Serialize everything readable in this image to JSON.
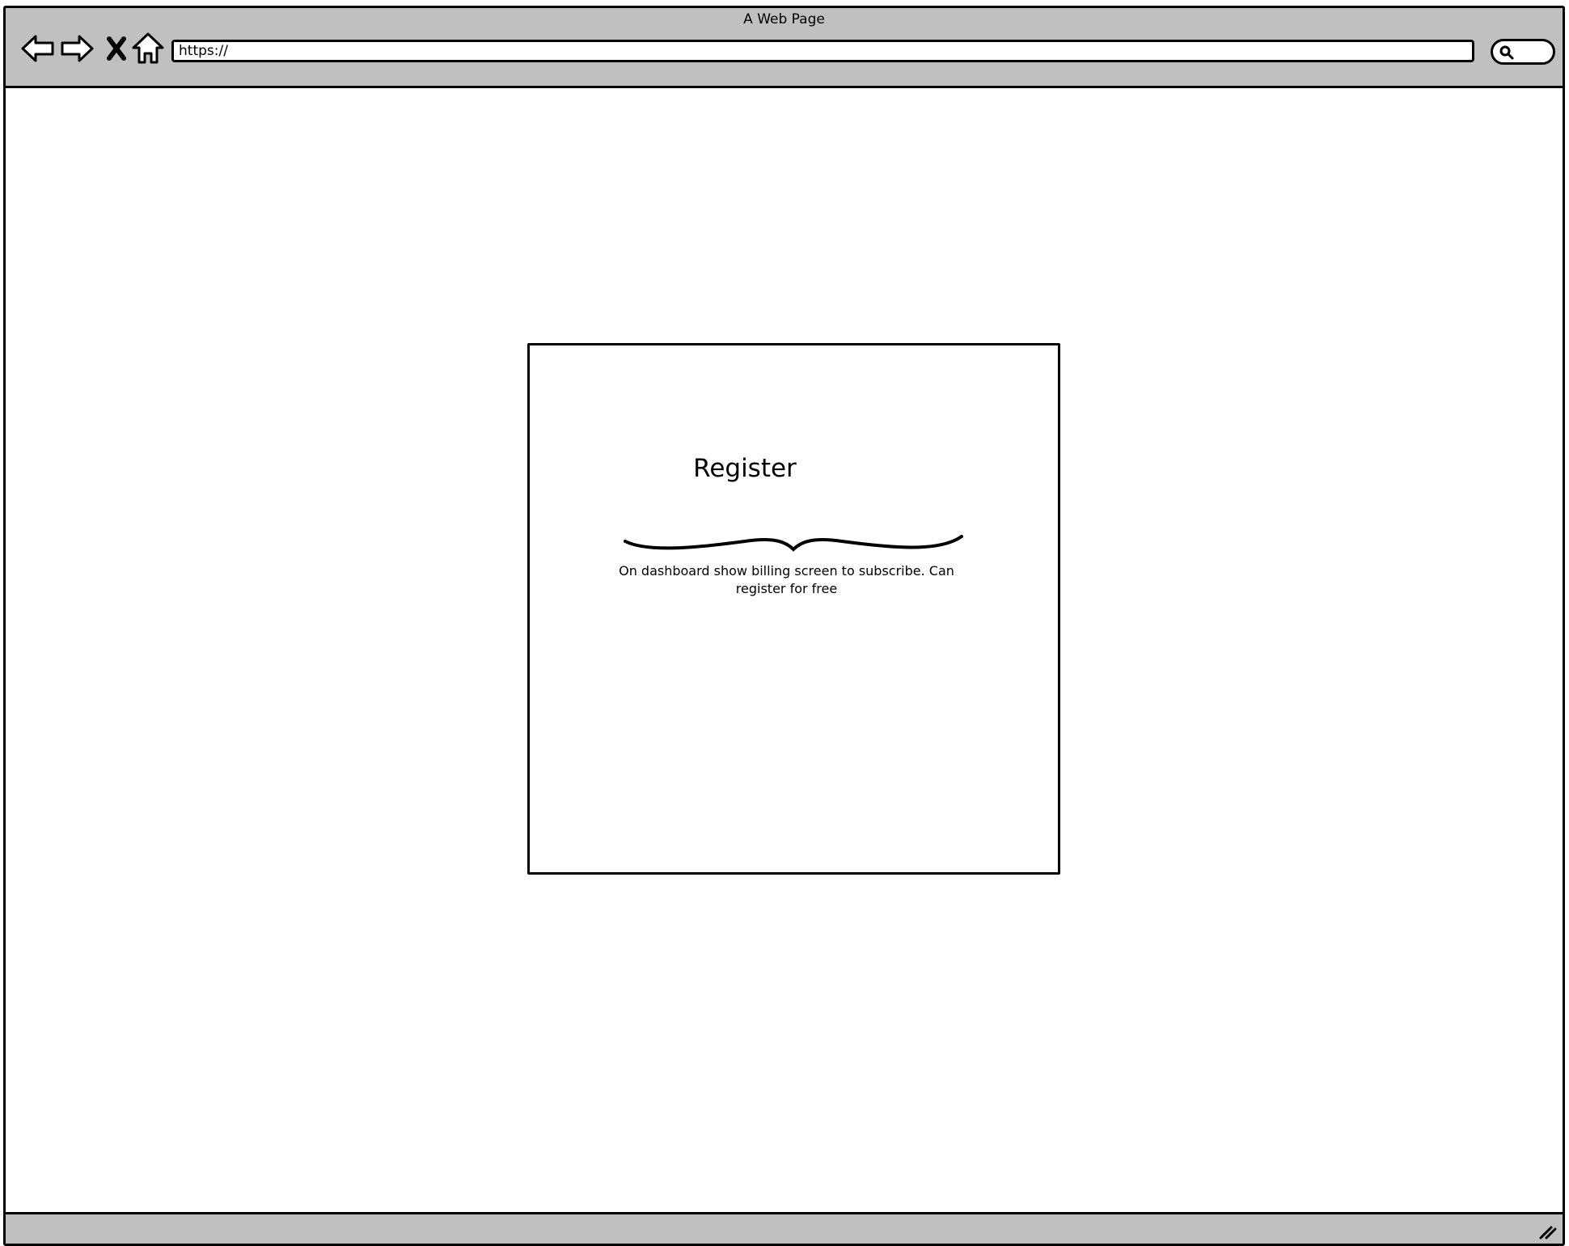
{
  "window": {
    "title": "A Web Page"
  },
  "toolbar": {
    "back_icon": "back-arrow-icon",
    "forward_icon": "forward-arrow-icon",
    "stop_icon": "close-x-icon",
    "home_icon": "home-icon",
    "url": "https://",
    "search_icon": "search-icon"
  },
  "main": {
    "register_title": "Register",
    "annotation": "On dashboard show billing screen to subscribe. Can register for free"
  },
  "colors": {
    "chrome": "#c0c0c0",
    "stroke": "#000000",
    "background": "#ffffff"
  }
}
